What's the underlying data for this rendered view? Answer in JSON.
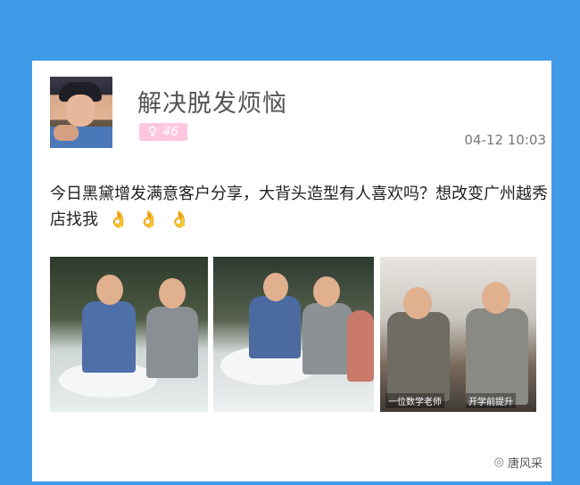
{
  "post": {
    "author": "解决脱发烦恼",
    "badge_value": "46",
    "timestamp": "04-12 10:03",
    "text": "今日黑黛增发满意客户分享，大背头造型有人喜欢吗？想改变广州越秀店找我",
    "emoji_icons": [
      "ok-hand-icon",
      "ok-hand-icon",
      "ok-hand-icon"
    ]
  },
  "photos": [
    {
      "name": "photo-clients-seated-1"
    },
    {
      "name": "photo-clients-seated-2"
    },
    {
      "name": "photo-before-after",
      "captions": [
        "一位数学老师",
        "开学前提升"
      ]
    }
  ],
  "watermark": {
    "label": "唐风采",
    "icon": "wechat-icon"
  },
  "colors": {
    "background": "#3f9ae8",
    "card": "#ffffff",
    "badge": "#ffc7de"
  }
}
